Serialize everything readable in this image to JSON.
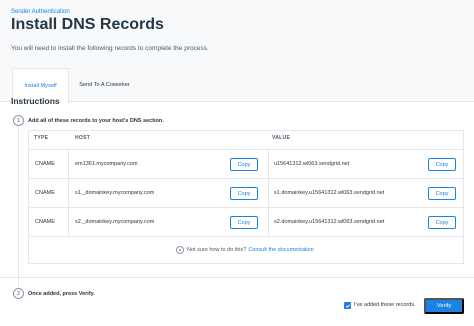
{
  "header": {
    "breadcrumb": "Sender Authentication",
    "title": "Install DNS Records",
    "intro": "You will need to install the following records to complete the process."
  },
  "tabs": [
    {
      "label": "Install Myself",
      "active": true
    },
    {
      "label": "Send To A Coworker",
      "active": false
    }
  ],
  "instructions": {
    "title": "Instructions",
    "step1": {
      "number": "1",
      "text": "Add all of these records to your host's DNS section."
    },
    "step2": {
      "number": "2",
      "text": "Once added, press Verify."
    }
  },
  "table": {
    "headers": {
      "type": "TYPE",
      "host": "HOST",
      "value": "VALUE"
    },
    "rows": [
      {
        "type": "CNAME",
        "host": "em1361.mycompany.com",
        "value": "u15641312.wl063.sendgrid.net"
      },
      {
        "type": "CNAME",
        "host": "s1._domainkey.mycompany.com",
        "value": "s1.domainkey.u15641312.wl063.sendgrid.net"
      },
      {
        "type": "CNAME",
        "host": "s2._domainkey.mycompany.com",
        "value": "s2.domainkey.u15641312.wl063.sendgrid.net"
      }
    ],
    "copy_label": "Copy"
  },
  "help": {
    "text": "Not sure how to do this?",
    "link": "Consult the documentation"
  },
  "footer": {
    "checkbox_label": "I've added these records.",
    "checkbox_checked": true,
    "verify_label": "Verify"
  },
  "colors": {
    "accent": "#1a82e2",
    "text": "#263746",
    "border": "#e4e7eb"
  }
}
